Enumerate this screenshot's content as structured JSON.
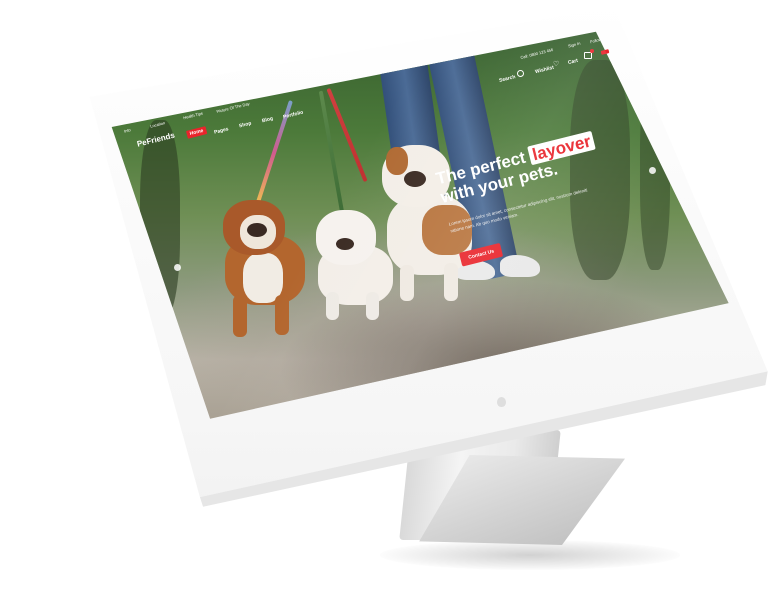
{
  "topbar": {
    "email": "Info",
    "location": "Location",
    "tips": "Health Tips",
    "picture": "Picture Of The Day",
    "phone": "Call: 0800 123 456",
    "signin": "Sign In",
    "social": "Follow"
  },
  "header": {
    "logo": "PeFriends",
    "nav": {
      "home": "Home",
      "pages": "Pages",
      "shop": "Shop",
      "blog": "Blog",
      "portfolio": "Portfolio"
    },
    "search": "Search",
    "wishlist": "Wishlist",
    "cart": "Cart"
  },
  "hero": {
    "headline_pre": "The perfect ",
    "headline_highlight": "layover",
    "headline_line2": "with your pets.",
    "lead": "Lorem ipsum dolor sit amet, consectetur adipiscing elit, nostrum deleniti ratione nam. Ab quo modo veniam.",
    "cta": "Contact Us"
  },
  "colors": {
    "accent": "#e9242b",
    "monitor": "#f4f4f4"
  }
}
